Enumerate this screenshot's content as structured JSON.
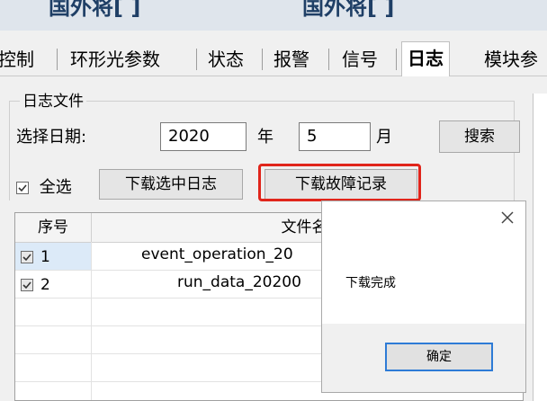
{
  "header": {
    "left_fragment": "国外将[ ]",
    "right_fragment": "国外将[ ]"
  },
  "tabs": [
    {
      "label": "控制"
    },
    {
      "label": "环形光参数"
    },
    {
      "label": "状态"
    },
    {
      "label": "报警"
    },
    {
      "label": "信号"
    },
    {
      "label": "日志",
      "active": true
    },
    {
      "label": "模块参"
    }
  ],
  "log_files": {
    "group_title": "日志文件",
    "date_label": "选择日期:",
    "year_value": "2020",
    "year_unit": "年",
    "month_value": "5",
    "month_unit": "月",
    "search_button": "搜索",
    "select_all_label": "全选",
    "select_all_checked": true,
    "download_selected_button": "下载选中日志",
    "download_fault_button": "下载故障记录"
  },
  "table": {
    "columns": [
      "序号",
      "文件名"
    ],
    "rows": [
      {
        "index": "1",
        "filename": "event_operation_20",
        "checked": true
      },
      {
        "index": "2",
        "filename": "run_data_20200",
        "checked": true
      }
    ]
  },
  "dialog": {
    "message": "下载完成",
    "ok_button": "确定"
  },
  "colors": {
    "highlight": "#e0251b",
    "selection": "#dceaf8",
    "focus_border": "#2e7bd6"
  }
}
